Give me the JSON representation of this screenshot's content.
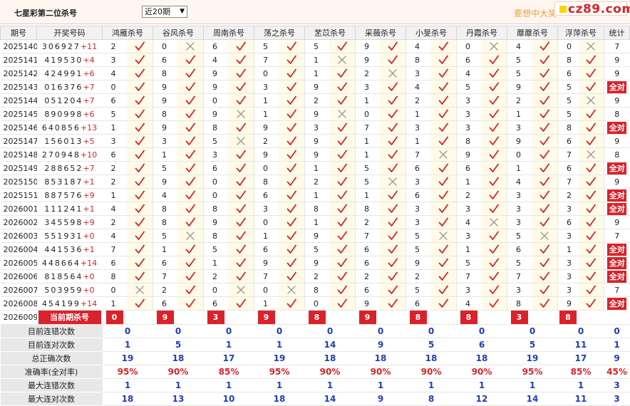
{
  "page": {
    "title": "七星彩第二位杀号",
    "select_value": "近20期",
    "promo": "要想中大奖",
    "logo": "cz89.com"
  },
  "headers": [
    "期号",
    "开奖号码",
    "鸿雁杀号",
    "谷风杀号",
    "周南杀号",
    "荡之杀号",
    "苤苡杀号",
    "采薇杀号",
    "小旻杀号",
    "丹霞杀号",
    "蘼蘼杀号",
    "浮萍杀号",
    "统计"
  ],
  "rows": [
    {
      "period": "2025140",
      "draw": "306927",
      "sum": "+11",
      "picks": [
        [
          2,
          1
        ],
        [
          0,
          0
        ],
        [
          6,
          1
        ],
        [
          5,
          1
        ],
        [
          5,
          1
        ],
        [
          9,
          1
        ],
        [
          4,
          1
        ],
        [
          0,
          0
        ],
        [
          4,
          1
        ],
        [
          0,
          0
        ]
      ],
      "stat": "7"
    },
    {
      "period": "2025141",
      "draw": "419530",
      "sum": "+4",
      "picks": [
        [
          3,
          1
        ],
        [
          6,
          1
        ],
        [
          4,
          1
        ],
        [
          7,
          1
        ],
        [
          1,
          0
        ],
        [
          9,
          1
        ],
        [
          8,
          1
        ],
        [
          6,
          1
        ],
        [
          5,
          1
        ],
        [
          8,
          1
        ]
      ],
      "stat": "9"
    },
    {
      "period": "2025142",
      "draw": "424991",
      "sum": "+6",
      "picks": [
        [
          4,
          1
        ],
        [
          8,
          1
        ],
        [
          9,
          1
        ],
        [
          0,
          1
        ],
        [
          1,
          1
        ],
        [
          2,
          0
        ],
        [
          3,
          1
        ],
        [
          4,
          1
        ],
        [
          5,
          1
        ],
        [
          6,
          1
        ]
      ],
      "stat": "9"
    },
    {
      "period": "2025143",
      "draw": "016376",
      "sum": "+7",
      "picks": [
        [
          0,
          1
        ],
        [
          9,
          1
        ],
        [
          9,
          1
        ],
        [
          3,
          1
        ],
        [
          9,
          1
        ],
        [
          3,
          1
        ],
        [
          4,
          1
        ],
        [
          5,
          1
        ],
        [
          9,
          1
        ],
        [
          5,
          1
        ]
      ],
      "stat": "全对"
    },
    {
      "period": "2025144",
      "draw": "051204",
      "sum": "+7",
      "picks": [
        [
          6,
          1
        ],
        [
          9,
          1
        ],
        [
          0,
          1
        ],
        [
          1,
          1
        ],
        [
          2,
          1
        ],
        [
          1,
          1
        ],
        [
          2,
          1
        ],
        [
          3,
          1
        ],
        [
          2,
          1
        ],
        [
          5,
          0
        ]
      ],
      "stat": "9"
    },
    {
      "period": "2025145",
      "draw": "890998",
      "sum": "+6",
      "picks": [
        [
          5,
          1
        ],
        [
          8,
          1
        ],
        [
          9,
          0
        ],
        [
          1,
          1
        ],
        [
          9,
          0
        ],
        [
          0,
          1
        ],
        [
          1,
          1
        ],
        [
          3,
          1
        ],
        [
          1,
          1
        ],
        [
          5,
          1
        ]
      ],
      "stat": "8"
    },
    {
      "period": "2025146",
      "draw": "640856",
      "sum": "+13",
      "picks": [
        [
          1,
          1
        ],
        [
          9,
          1
        ],
        [
          8,
          1
        ],
        [
          9,
          1
        ],
        [
          3,
          1
        ],
        [
          7,
          1
        ],
        [
          3,
          1
        ],
        [
          3,
          1
        ],
        [
          3,
          1
        ],
        [
          8,
          1
        ]
      ],
      "stat": "全对"
    },
    {
      "period": "2025147",
      "draw": "156013",
      "sum": "+5",
      "picks": [
        [
          3,
          1
        ],
        [
          3,
          1
        ],
        [
          5,
          0
        ],
        [
          2,
          1
        ],
        [
          9,
          1
        ],
        [
          1,
          1
        ],
        [
          1,
          1
        ],
        [
          8,
          1
        ],
        [
          9,
          1
        ],
        [
          6,
          1
        ]
      ],
      "stat": "9"
    },
    {
      "period": "2025148",
      "draw": "270948",
      "sum": "+10",
      "picks": [
        [
          6,
          1
        ],
        [
          1,
          1
        ],
        [
          3,
          1
        ],
        [
          9,
          1
        ],
        [
          9,
          1
        ],
        [
          1,
          1
        ],
        [
          7,
          0
        ],
        [
          9,
          1
        ],
        [
          0,
          1
        ],
        [
          7,
          0
        ]
      ],
      "stat": "8"
    },
    {
      "period": "2025149",
      "draw": "288652",
      "sum": "+7",
      "picks": [
        [
          2,
          1
        ],
        [
          5,
          1
        ],
        [
          6,
          1
        ],
        [
          0,
          1
        ],
        [
          1,
          1
        ],
        [
          5,
          1
        ],
        [
          6,
          1
        ],
        [
          6,
          1
        ],
        [
          1,
          1
        ],
        [
          6,
          1
        ]
      ],
      "stat": "全对"
    },
    {
      "period": "2025150",
      "draw": "853187",
      "sum": "+1",
      "picks": [
        [
          2,
          1
        ],
        [
          9,
          1
        ],
        [
          0,
          1
        ],
        [
          8,
          1
        ],
        [
          2,
          1
        ],
        [
          5,
          0
        ],
        [
          3,
          1
        ],
        [
          1,
          1
        ],
        [
          4,
          1
        ],
        [
          7,
          1
        ]
      ],
      "stat": "9"
    },
    {
      "period": "2025151",
      "draw": "887576",
      "sum": "+9",
      "picks": [
        [
          1,
          1
        ],
        [
          4,
          1
        ],
        [
          0,
          1
        ],
        [
          6,
          1
        ],
        [
          1,
          1
        ],
        [
          1,
          1
        ],
        [
          6,
          1
        ],
        [
          2,
          1
        ],
        [
          3,
          1
        ],
        [
          2,
          1
        ]
      ],
      "stat": "全对"
    },
    {
      "period": "2026001",
      "draw": "111241",
      "sum": "+1",
      "picks": [
        [
          4,
          1
        ],
        [
          8,
          1
        ],
        [
          8,
          1
        ],
        [
          3,
          1
        ],
        [
          8,
          1
        ],
        [
          8,
          1
        ],
        [
          3,
          1
        ],
        [
          3,
          1
        ],
        [
          3,
          1
        ],
        [
          3,
          1
        ]
      ],
      "stat": "全对"
    },
    {
      "period": "2026002",
      "draw": "345598",
      "sum": "+9",
      "picks": [
        [
          2,
          1
        ],
        [
          8,
          1
        ],
        [
          9,
          1
        ],
        [
          0,
          1
        ],
        [
          1,
          1
        ],
        [
          2,
          1
        ],
        [
          3,
          1
        ],
        [
          4,
          0
        ],
        [
          3,
          1
        ],
        [
          6,
          1
        ]
      ],
      "stat": "9"
    },
    {
      "period": "2026003",
      "draw": "551931",
      "sum": "+0",
      "picks": [
        [
          4,
          1
        ],
        [
          5,
          0
        ],
        [
          8,
          1
        ],
        [
          1,
          1
        ],
        [
          9,
          1
        ],
        [
          7,
          1
        ],
        [
          5,
          0
        ],
        [
          3,
          1
        ],
        [
          5,
          0
        ],
        [
          3,
          1
        ]
      ],
      "stat": "7"
    },
    {
      "period": "2026004",
      "draw": "441536",
      "sum": "+1",
      "picks": [
        [
          7,
          1
        ],
        [
          1,
          1
        ],
        [
          5,
          1
        ],
        [
          6,
          1
        ],
        [
          5,
          1
        ],
        [
          6,
          1
        ],
        [
          5,
          1
        ],
        [
          1,
          1
        ],
        [
          6,
          1
        ],
        [
          1,
          1
        ]
      ],
      "stat": "全对"
    },
    {
      "period": "2026005",
      "draw": "448664",
      "sum": "+14",
      "picks": [
        [
          6,
          1
        ],
        [
          6,
          1
        ],
        [
          1,
          1
        ],
        [
          9,
          1
        ],
        [
          9,
          1
        ],
        [
          6,
          1
        ],
        [
          9,
          1
        ],
        [
          5,
          1
        ],
        [
          5,
          1
        ],
        [
          3,
          1
        ]
      ],
      "stat": "全对"
    },
    {
      "period": "2026006",
      "draw": "818564",
      "sum": "+0",
      "picks": [
        [
          8,
          1
        ],
        [
          7,
          1
        ],
        [
          2,
          1
        ],
        [
          7,
          1
        ],
        [
          2,
          1
        ],
        [
          2,
          1
        ],
        [
          2,
          1
        ],
        [
          7,
          1
        ],
        [
          7,
          1
        ],
        [
          3,
          1
        ]
      ],
      "stat": "全对"
    },
    {
      "period": "2026007",
      "draw": "503959",
      "sum": "+0",
      "picks": [
        [
          0,
          0
        ],
        [
          2,
          1
        ],
        [
          0,
          0
        ],
        [
          0,
          0
        ],
        [
          8,
          1
        ],
        [
          6,
          1
        ],
        [
          5,
          1
        ],
        [
          3,
          1
        ],
        [
          3,
          1
        ],
        [
          3,
          1
        ]
      ],
      "stat": "7"
    },
    {
      "period": "2026008",
      "draw": "454199",
      "sum": "+14",
      "picks": [
        [
          1,
          1
        ],
        [
          6,
          1
        ],
        [
          6,
          1
        ],
        [
          1,
          1
        ],
        [
          0,
          1
        ],
        [
          9,
          1
        ],
        [
          6,
          1
        ],
        [
          4,
          1
        ],
        [
          8,
          1
        ],
        [
          9,
          1
        ]
      ],
      "stat": "全对"
    }
  ],
  "current": {
    "period": "2026009",
    "label": "当前期杀号",
    "picks": [
      "0",
      "9",
      "3",
      "9",
      "8",
      "9",
      "8",
      "8",
      "3",
      "8"
    ]
  },
  "stats": [
    {
      "label": "目前连错次数",
      "values": [
        "0",
        "0",
        "0",
        "0",
        "0",
        "0",
        "0",
        "0",
        "0",
        "0",
        "0"
      ],
      "red": false
    },
    {
      "label": "目前连对次数",
      "values": [
        "1",
        "5",
        "1",
        "1",
        "14",
        "9",
        "5",
        "6",
        "5",
        "11",
        "1"
      ],
      "red": false
    },
    {
      "label": "总正确次数",
      "values": [
        "19",
        "18",
        "17",
        "19",
        "18",
        "18",
        "18",
        "18",
        "19",
        "17",
        "9"
      ],
      "red": false
    },
    {
      "label": "准确率(全对率)",
      "values": [
        "95%",
        "90%",
        "85%",
        "95%",
        "90%",
        "90%",
        "90%",
        "90%",
        "95%",
        "85%",
        "45%"
      ],
      "red": true
    },
    {
      "label": "最大连错次数",
      "values": [
        "1",
        "1",
        "1",
        "1",
        "1",
        "1",
        "1",
        "1",
        "1",
        "1",
        "3"
      ],
      "red": false
    },
    {
      "label": "最大连对次数",
      "values": [
        "18",
        "13",
        "10",
        "18",
        "14",
        "9",
        "8",
        "12",
        "14",
        "11",
        "3"
      ],
      "red": false
    }
  ]
}
